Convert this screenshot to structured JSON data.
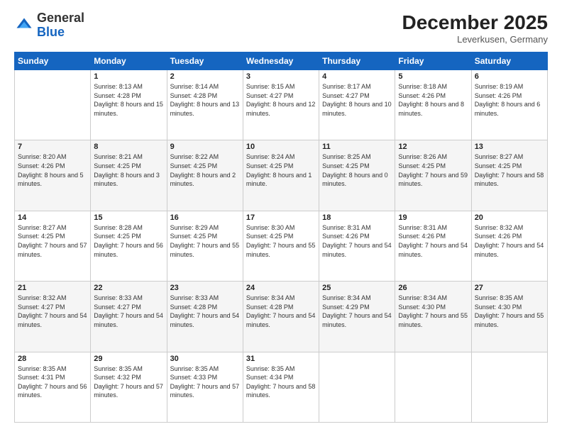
{
  "logo": {
    "general": "General",
    "blue": "Blue"
  },
  "header": {
    "month": "December 2025",
    "location": "Leverkusen, Germany"
  },
  "weekdays": [
    "Sunday",
    "Monday",
    "Tuesday",
    "Wednesday",
    "Thursday",
    "Friday",
    "Saturday"
  ],
  "weeks": [
    [
      {
        "day": null
      },
      {
        "day": 1,
        "sunrise": "8:13 AM",
        "sunset": "4:28 PM",
        "daylight": "8 hours and 15 minutes."
      },
      {
        "day": 2,
        "sunrise": "8:14 AM",
        "sunset": "4:28 PM",
        "daylight": "8 hours and 13 minutes."
      },
      {
        "day": 3,
        "sunrise": "8:15 AM",
        "sunset": "4:27 PM",
        "daylight": "8 hours and 12 minutes."
      },
      {
        "day": 4,
        "sunrise": "8:17 AM",
        "sunset": "4:27 PM",
        "daylight": "8 hours and 10 minutes."
      },
      {
        "day": 5,
        "sunrise": "8:18 AM",
        "sunset": "4:26 PM",
        "daylight": "8 hours and 8 minutes."
      },
      {
        "day": 6,
        "sunrise": "8:19 AM",
        "sunset": "4:26 PM",
        "daylight": "8 hours and 6 minutes."
      }
    ],
    [
      {
        "day": 7,
        "sunrise": "8:20 AM",
        "sunset": "4:26 PM",
        "daylight": "8 hours and 5 minutes."
      },
      {
        "day": 8,
        "sunrise": "8:21 AM",
        "sunset": "4:25 PM",
        "daylight": "8 hours and 3 minutes."
      },
      {
        "day": 9,
        "sunrise": "8:22 AM",
        "sunset": "4:25 PM",
        "daylight": "8 hours and 2 minutes."
      },
      {
        "day": 10,
        "sunrise": "8:24 AM",
        "sunset": "4:25 PM",
        "daylight": "8 hours and 1 minute."
      },
      {
        "day": 11,
        "sunrise": "8:25 AM",
        "sunset": "4:25 PM",
        "daylight": "8 hours and 0 minutes."
      },
      {
        "day": 12,
        "sunrise": "8:26 AM",
        "sunset": "4:25 PM",
        "daylight": "7 hours and 59 minutes."
      },
      {
        "day": 13,
        "sunrise": "8:27 AM",
        "sunset": "4:25 PM",
        "daylight": "7 hours and 58 minutes."
      }
    ],
    [
      {
        "day": 14,
        "sunrise": "8:27 AM",
        "sunset": "4:25 PM",
        "daylight": "7 hours and 57 minutes."
      },
      {
        "day": 15,
        "sunrise": "8:28 AM",
        "sunset": "4:25 PM",
        "daylight": "7 hours and 56 minutes."
      },
      {
        "day": 16,
        "sunrise": "8:29 AM",
        "sunset": "4:25 PM",
        "daylight": "7 hours and 55 minutes."
      },
      {
        "day": 17,
        "sunrise": "8:30 AM",
        "sunset": "4:25 PM",
        "daylight": "7 hours and 55 minutes."
      },
      {
        "day": 18,
        "sunrise": "8:31 AM",
        "sunset": "4:26 PM",
        "daylight": "7 hours and 54 minutes."
      },
      {
        "day": 19,
        "sunrise": "8:31 AM",
        "sunset": "4:26 PM",
        "daylight": "7 hours and 54 minutes."
      },
      {
        "day": 20,
        "sunrise": "8:32 AM",
        "sunset": "4:26 PM",
        "daylight": "7 hours and 54 minutes."
      }
    ],
    [
      {
        "day": 21,
        "sunrise": "8:32 AM",
        "sunset": "4:27 PM",
        "daylight": "7 hours and 54 minutes."
      },
      {
        "day": 22,
        "sunrise": "8:33 AM",
        "sunset": "4:27 PM",
        "daylight": "7 hours and 54 minutes."
      },
      {
        "day": 23,
        "sunrise": "8:33 AM",
        "sunset": "4:28 PM",
        "daylight": "7 hours and 54 minutes."
      },
      {
        "day": 24,
        "sunrise": "8:34 AM",
        "sunset": "4:28 PM",
        "daylight": "7 hours and 54 minutes."
      },
      {
        "day": 25,
        "sunrise": "8:34 AM",
        "sunset": "4:29 PM",
        "daylight": "7 hours and 54 minutes."
      },
      {
        "day": 26,
        "sunrise": "8:34 AM",
        "sunset": "4:30 PM",
        "daylight": "7 hours and 55 minutes."
      },
      {
        "day": 27,
        "sunrise": "8:35 AM",
        "sunset": "4:30 PM",
        "daylight": "7 hours and 55 minutes."
      }
    ],
    [
      {
        "day": 28,
        "sunrise": "8:35 AM",
        "sunset": "4:31 PM",
        "daylight": "7 hours and 56 minutes."
      },
      {
        "day": 29,
        "sunrise": "8:35 AM",
        "sunset": "4:32 PM",
        "daylight": "7 hours and 57 minutes."
      },
      {
        "day": 30,
        "sunrise": "8:35 AM",
        "sunset": "4:33 PM",
        "daylight": "7 hours and 57 minutes."
      },
      {
        "day": 31,
        "sunrise": "8:35 AM",
        "sunset": "4:34 PM",
        "daylight": "7 hours and 58 minutes."
      },
      {
        "day": null
      },
      {
        "day": null
      },
      {
        "day": null
      }
    ]
  ]
}
